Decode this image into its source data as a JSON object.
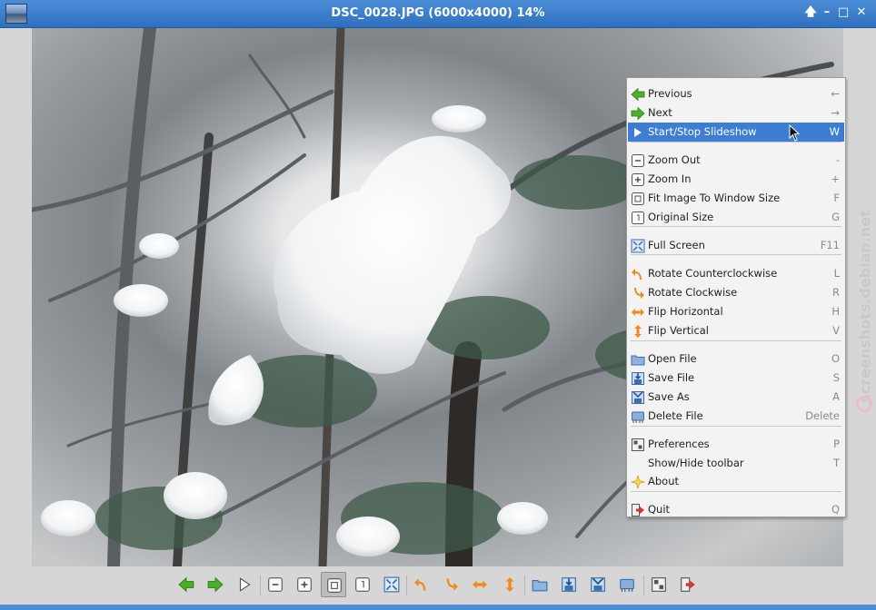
{
  "window": {
    "title": "DSC_0028.JPG (6000x4000) 14%",
    "controls": {
      "up": "🡅",
      "minimize": "–",
      "maximize": "□",
      "close": "✕"
    }
  },
  "watermark": {
    "text": "screenshots.debian.net"
  },
  "menu": {
    "items": [
      {
        "label": "Previous",
        "shortcut": "←",
        "icon": "arrow-left-icon"
      },
      {
        "label": "Next",
        "shortcut": "→",
        "icon": "arrow-right-icon"
      },
      {
        "label": "Start/Stop Slideshow",
        "shortcut": "W",
        "icon": "play-icon",
        "active": true
      },
      {
        "label": "Zoom Out",
        "shortcut": "-",
        "icon": "zoom-out-icon"
      },
      {
        "label": "Zoom In",
        "shortcut": "+",
        "icon": "zoom-in-icon"
      },
      {
        "label": "Fit Image To Window Size",
        "shortcut": "F",
        "icon": "fit-window-icon"
      },
      {
        "label": "Original Size",
        "shortcut": "G",
        "icon": "original-size-icon"
      },
      {
        "label": "Full Screen",
        "shortcut": "F11",
        "icon": "fullscreen-icon"
      },
      {
        "label": "Rotate Counterclockwise",
        "shortcut": "L",
        "icon": "rotate-ccw-icon"
      },
      {
        "label": "Rotate Clockwise",
        "shortcut": "R",
        "icon": "rotate-cw-icon"
      },
      {
        "label": "Flip Horizontal",
        "shortcut": "H",
        "icon": "flip-horizontal-icon"
      },
      {
        "label": "Flip Vertical",
        "shortcut": "V",
        "icon": "flip-vertical-icon"
      },
      {
        "label": "Open File",
        "shortcut": "O",
        "icon": "open-folder-icon"
      },
      {
        "label": "Save File",
        "shortcut": "S",
        "icon": "save-icon"
      },
      {
        "label": "Save As",
        "shortcut": "A",
        "icon": "save-as-icon"
      },
      {
        "label": "Delete File",
        "shortcut": "Delete",
        "icon": "delete-icon"
      },
      {
        "label": "Preferences",
        "shortcut": "P",
        "icon": "preferences-icon"
      },
      {
        "label": "Show/Hide toolbar",
        "shortcut": "T",
        "icon": ""
      },
      {
        "label": "About",
        "shortcut": "",
        "icon": "about-star-icon"
      },
      {
        "label": "Quit",
        "shortcut": "Q",
        "icon": "quit-icon"
      }
    ]
  },
  "toolbar": {
    "buttons": [
      {
        "name": "previous",
        "icon": "arrow-left-icon"
      },
      {
        "name": "next",
        "icon": "arrow-right-icon"
      },
      {
        "name": "slideshow",
        "icon": "play-icon"
      },
      {
        "name": "zoom-out",
        "icon": "zoom-out-icon"
      },
      {
        "name": "zoom-in",
        "icon": "zoom-in-icon"
      },
      {
        "name": "fit-window",
        "icon": "fit-window-icon",
        "pressed": true
      },
      {
        "name": "original-size",
        "icon": "original-size-icon"
      },
      {
        "name": "fullscreen",
        "icon": "fullscreen-icon"
      },
      {
        "name": "rotate-ccw",
        "icon": "rotate-ccw-icon"
      },
      {
        "name": "rotate-cw",
        "icon": "rotate-cw-icon"
      },
      {
        "name": "flip-horizontal",
        "icon": "flip-horizontal-icon"
      },
      {
        "name": "flip-vertical",
        "icon": "flip-vertical-icon"
      },
      {
        "name": "open-file",
        "icon": "open-folder-icon"
      },
      {
        "name": "save-file",
        "icon": "save-icon"
      },
      {
        "name": "save-as",
        "icon": "save-as-icon"
      },
      {
        "name": "delete-file",
        "icon": "delete-icon"
      },
      {
        "name": "preferences",
        "icon": "preferences-icon"
      },
      {
        "name": "quit",
        "icon": "quit-icon"
      }
    ]
  },
  "colors": {
    "titlebar": "#3a7bc8",
    "menu_highlight": "#3d7ed4",
    "green_arrow": "#4caf2a",
    "orange_arrow": "#f08a1c",
    "blue_icon": "#3b6fb0"
  }
}
